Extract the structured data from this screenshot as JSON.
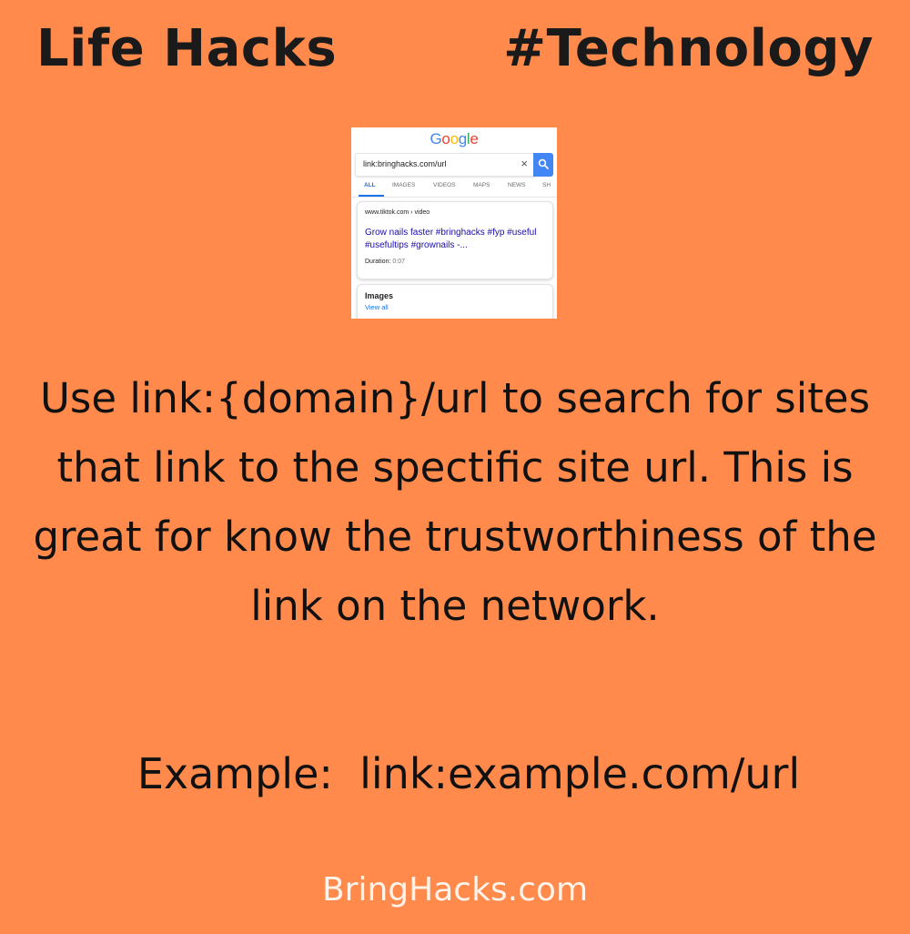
{
  "header": {
    "left_title": "Life Hacks",
    "right_title": "#Technology"
  },
  "screenshot": {
    "logo_letters": [
      {
        "ch": "G",
        "color": "#4285f4"
      },
      {
        "ch": "o",
        "color": "#ea4335"
      },
      {
        "ch": "o",
        "color": "#fbbc05"
      },
      {
        "ch": "g",
        "color": "#4285f4"
      },
      {
        "ch": "l",
        "color": "#34a853"
      },
      {
        "ch": "e",
        "color": "#ea4335"
      }
    ],
    "search_query": "link:bringhacks.com/url",
    "clear_icon": "×",
    "search_icon": "search-icon",
    "tabs": [
      "ALL",
      "IMAGES",
      "VIDEOS",
      "MAPS",
      "NEWS",
      "SH"
    ],
    "active_tab": "ALL",
    "result": {
      "url": "www.tiktok.com › video",
      "title": "Grow nails faster #bringhacks #fyp #useful #usefultips #grownails -...",
      "duration_label": "Duration:",
      "duration_value": "0:07"
    },
    "images_section": {
      "title": "Images",
      "link": "View all"
    }
  },
  "body": {
    "description": "Use link:{domain}/url to search for sites that link to the spectific site url. This is great for know the trustworthiness of the link on the network.",
    "example": "Example:  link:example.com/url"
  },
  "footer": {
    "site": "BringHacks.com"
  },
  "colors": {
    "background": "#ff8a4c",
    "google_blue": "#4285f4",
    "link_blue": "#1a0dab"
  }
}
